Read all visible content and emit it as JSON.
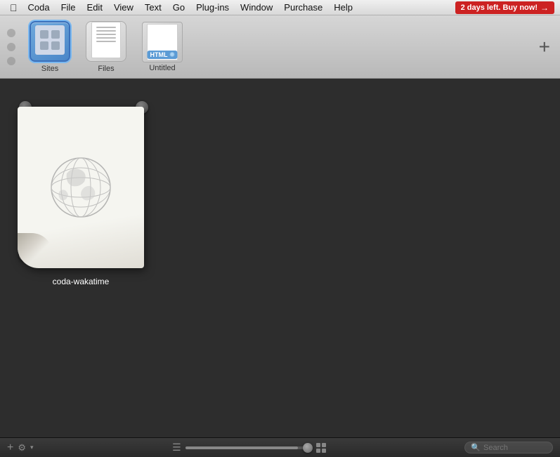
{
  "menubar": {
    "apple": "&#xf8ff;",
    "items": [
      {
        "id": "coda",
        "label": "Coda"
      },
      {
        "id": "file",
        "label": "File"
      },
      {
        "id": "edit",
        "label": "Edit"
      },
      {
        "id": "view",
        "label": "View"
      },
      {
        "id": "text",
        "label": "Text"
      },
      {
        "id": "go",
        "label": "Go"
      },
      {
        "id": "plugins",
        "label": "Plug-ins"
      },
      {
        "id": "window",
        "label": "Window"
      },
      {
        "id": "purchase",
        "label": "Purchase"
      },
      {
        "id": "help",
        "label": "Help"
      }
    ],
    "trial": "2 days left. Buy now!"
  },
  "toolbar": {
    "tabs": [
      {
        "id": "sites",
        "label": "Sites",
        "type": "sites"
      },
      {
        "id": "files",
        "label": "Files",
        "type": "files"
      },
      {
        "id": "untitled",
        "label": "Untitled",
        "type": "html",
        "badge": "HTML"
      }
    ],
    "add_label": "+"
  },
  "main": {
    "plugin_name": "coda-wakatime"
  },
  "bottombar": {
    "search_placeholder": "Search"
  }
}
